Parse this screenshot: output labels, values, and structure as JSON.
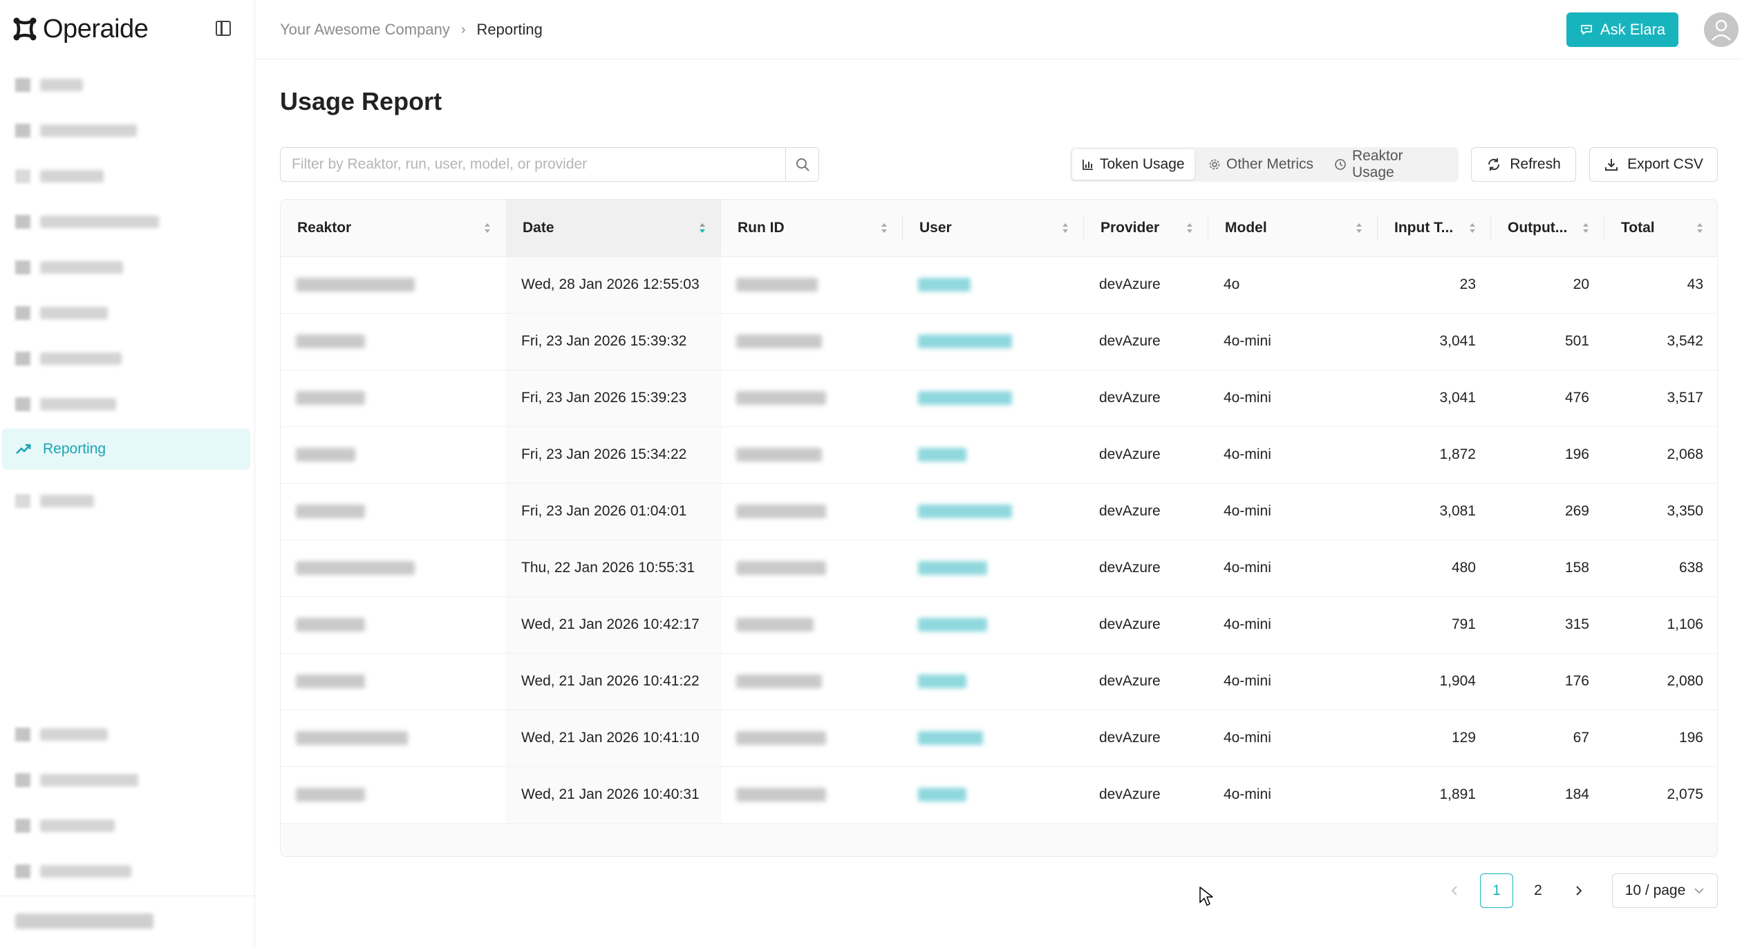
{
  "app": {
    "name": "Operaide"
  },
  "sidebar": {
    "active_item": {
      "label": "Reporting",
      "icon": "trend-up-icon"
    }
  },
  "header": {
    "breadcrumb": {
      "company": "Your Awesome Company",
      "current": "Reporting"
    },
    "ask_button": {
      "label": "Ask Elara",
      "icon": "chat-icon"
    }
  },
  "page": {
    "title": "Usage Report"
  },
  "filter": {
    "placeholder": "Filter by Reaktor, run, user, model, or provider",
    "value": ""
  },
  "view_tabs": [
    {
      "label": "Token Usage",
      "icon": "bar-chart-icon",
      "active": true
    },
    {
      "label": "Other Metrics",
      "icon": "gear-icon",
      "active": false
    },
    {
      "label": "Reaktor Usage",
      "icon": "clock-icon",
      "active": false
    }
  ],
  "actions": {
    "refresh_label": "Refresh",
    "export_label": "Export CSV"
  },
  "table": {
    "columns": [
      "Reaktor",
      "Date",
      "Run ID",
      "User",
      "Provider",
      "Model",
      "Input T...",
      "Output...",
      "Total"
    ],
    "sorted_column": "Date",
    "rows": [
      {
        "date": "Wed, 28 Jan 2026 12:55:03",
        "provider": "devAzure",
        "model": "4o",
        "input": "23",
        "output": "20",
        "total": "43"
      },
      {
        "date": "Fri, 23 Jan 2026 15:39:32",
        "provider": "devAzure",
        "model": "4o-mini",
        "input": "3,041",
        "output": "501",
        "total": "3,542"
      },
      {
        "date": "Fri, 23 Jan 2026 15:39:23",
        "provider": "devAzure",
        "model": "4o-mini",
        "input": "3,041",
        "output": "476",
        "total": "3,517"
      },
      {
        "date": "Fri, 23 Jan 2026 15:34:22",
        "provider": "devAzure",
        "model": "4o-mini",
        "input": "1,872",
        "output": "196",
        "total": "2,068"
      },
      {
        "date": "Fri, 23 Jan 2026 01:04:01",
        "provider": "devAzure",
        "model": "4o-mini",
        "input": "3,081",
        "output": "269",
        "total": "3,350"
      },
      {
        "date": "Thu, 22 Jan 2026 10:55:31",
        "provider": "devAzure",
        "model": "4o-mini",
        "input": "480",
        "output": "158",
        "total": "638"
      },
      {
        "date": "Wed, 21 Jan 2026 10:42:17",
        "provider": "devAzure",
        "model": "4o-mini",
        "input": "791",
        "output": "315",
        "total": "1,106"
      },
      {
        "date": "Wed, 21 Jan 2026 10:41:22",
        "provider": "devAzure",
        "model": "4o-mini",
        "input": "1,904",
        "output": "176",
        "total": "2,080"
      },
      {
        "date": "Wed, 21 Jan 2026 10:41:10",
        "provider": "devAzure",
        "model": "4o-mini",
        "input": "129",
        "output": "67",
        "total": "196"
      },
      {
        "date": "Wed, 21 Jan 2026 10:40:31",
        "provider": "devAzure",
        "model": "4o-mini",
        "input": "1,891",
        "output": "184",
        "total": "2,075"
      }
    ]
  },
  "pagination": {
    "pages": [
      "1",
      "2"
    ],
    "current": "1",
    "page_size": "10 / page"
  },
  "colors": {
    "accent": "#18b4be",
    "active_bg": "#e7f8f9"
  }
}
